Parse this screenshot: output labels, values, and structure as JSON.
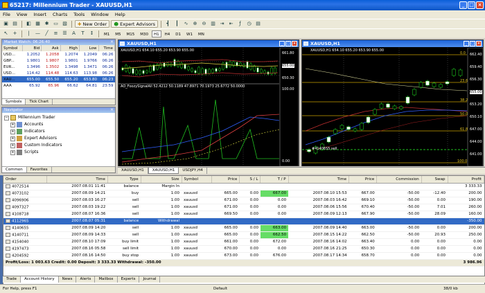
{
  "app": {
    "title": "65217: Millennium Trader - XAUUSD,H1"
  },
  "menu": [
    "File",
    "View",
    "Insert",
    "Charts",
    "Tools",
    "Window",
    "Help"
  ],
  "toolbar": {
    "new_order": "New Order",
    "expert_advisors": "Expert Advisors",
    "timeframes": [
      "M1",
      "M5",
      "M15",
      "M30",
      "H1",
      "H4",
      "D1",
      "W1",
      "MN"
    ]
  },
  "market_watch": {
    "title": "Market Watch: 06:26:40",
    "columns": [
      "Symbol",
      "Bid",
      "Ask",
      "High",
      "Low",
      "Time"
    ],
    "rows": [
      [
        "USD...",
        "1.2052",
        "1.2058",
        "1.2074",
        "1.2049",
        "06:26"
      ],
      [
        "GBP...",
        "1.9801",
        "1.9807",
        "1.9801",
        "1.9766",
        "06:26"
      ],
      [
        "EUR...",
        "1.3496",
        "1.3502",
        "1.3498",
        "1.3471",
        "06:26"
      ],
      [
        "USD...",
        "114.42",
        "114.48",
        "114.63",
        "113.98",
        "06:26"
      ],
      [
        "XAU...",
        "655.00",
        "655.50",
        "655.20",
        "653.80",
        "06:23"
      ],
      [
        "AAA",
        "65.92",
        "65.96",
        "66.62",
        "64.81",
        "23:59"
      ]
    ],
    "tabs": [
      "Symbols",
      "Tick Chart"
    ]
  },
  "navigator": {
    "title": "Navigator",
    "root": "Millennium Trader",
    "items": [
      "Accounts",
      "Indicators",
      "Expert Advisors",
      "Custom Indicators",
      "Scripts"
    ],
    "tabs": [
      "Common",
      "Favorites"
    ]
  },
  "chart1": {
    "title": "XAUUSD,H1",
    "info": "XAUUSD,H1  654.10 655.20 653.90 655.00",
    "indicator": "AO_FoozySignalAll  52.4212 50.1189 47.8971 70.1973 25.6772 50.0000",
    "prices": [
      "661.80",
      "655.00",
      "650.30"
    ],
    "indicator_scale": [
      "100.00",
      "0.00"
    ]
  },
  "chart2": {
    "title": "XAUUSD,H1",
    "info": "XAUUSD,H1  654.10 655.20 653.90 655.00",
    "prices": [
      "662.40",
      "659.40",
      "656.30",
      "655.00",
      "653.20",
      "650.10",
      "647.00",
      "644.00",
      "641.00"
    ],
    "levels": [
      "0.0",
      "23.6",
      "38.2",
      "50.0",
      "61.8",
      "100.0"
    ],
    "order_label": "#4140655 sell"
  },
  "chart_tabs": [
    "XAUUSD,H1",
    "XAUUSD,H1",
    "USDJPY,H4"
  ],
  "terminal": {
    "columns": [
      "Order",
      "Time",
      "Type",
      "Size",
      "Symbol",
      "Price",
      "S / L",
      "T / P",
      "Time",
      "Price",
      "Commission",
      "Swap",
      "Profit"
    ],
    "rows": [
      [
        "4072514",
        "2007.08.01 11:41",
        "balance",
        "Margin In",
        "",
        "",
        "",
        "",
        "",
        "",
        "",
        "",
        "3 333.33"
      ],
      [
        "4073102",
        "2007.08.09 14:21",
        "buy",
        "1.00",
        "xauusd",
        "665.00",
        "0.00",
        "667.00",
        "2007.08.10 15:53",
        "667.00",
        "-50.00",
        "-12.40",
        "200.00"
      ],
      [
        "4096906",
        "2007.08.03 16:27",
        "sell",
        "1.00",
        "xauusd",
        "671.00",
        "0.00",
        "0.00",
        "2007.08.03 16:42",
        "669.10",
        "-50.00",
        "0.00",
        "190.00"
      ],
      [
        "4097327",
        "2007.08.03 19:22",
        "sell",
        "1.00",
        "xauusd",
        "671.00",
        "0.00",
        "0.00",
        "2007.08.06 15:56",
        "670.40",
        "-50.00",
        "7.01",
        "260.00"
      ],
      [
        "4108718",
        "2007.08.07 16:36",
        "sell",
        "1.00",
        "xauusd",
        "669.50",
        "0.00",
        "0.00",
        "2007.08.09 12:13",
        "667.90",
        "-50.00",
        "28.09",
        "160.00"
      ],
      [
        "4112965",
        "2007.08.07 05:31",
        "balance",
        "Withdrawal",
        "",
        "",
        "",
        "",
        "",
        "",
        "",
        "",
        "-350.00"
      ],
      [
        "4140655",
        "2007.08.09 14:20",
        "sell",
        "1.00",
        "xauusd",
        "665.00",
        "0.00",
        "663.00",
        "2007.08.09 14:40",
        "663.00",
        "-50.00",
        "0.00",
        "200.00"
      ],
      [
        "4140711",
        "2007.08.09 14:33",
        "sell",
        "1.00",
        "xauusd",
        "665.00",
        "0.00",
        "662.50",
        "2007.08.15 14:22",
        "662.50",
        "-50.00",
        "20.93",
        "250.00"
      ],
      [
        "4154040",
        "2007.08.10 17:09",
        "buy limit",
        "1.00",
        "xauusd",
        "661.00",
        "0.00",
        "672.00",
        "2007.08.16 14:02",
        "663.40",
        "0.00",
        "0.00",
        "0.00"
      ],
      [
        "4197473",
        "2007.08.16 05:58",
        "sell limit",
        "1.00",
        "xauusd",
        "670.00",
        "0.00",
        "0.00",
        "2007.08.16 21:25",
        "650.30",
        "0.00",
        "0.00",
        "0.00"
      ],
      [
        "4204592",
        "2007.08.16 14:50",
        "buy stop",
        "1.00",
        "xauusd",
        "673.00",
        "0.00",
        "676.00",
        "2007.08.17 14:34",
        "658.70",
        "0.00",
        "0.00",
        "0.00"
      ]
    ],
    "summary": "Profit/Loss: 1 003.63  Credit: 0.00  Deposit: 3 333.33  Withdrawal: -350.00",
    "total": "3 986.96",
    "tabs": [
      "Trade",
      "Account History",
      "News",
      "Alerts",
      "Mailbox",
      "Experts",
      "Journal"
    ]
  },
  "status": {
    "help": "For Help, press F1",
    "profile": "Default",
    "traffic": "38/0 kb"
  }
}
